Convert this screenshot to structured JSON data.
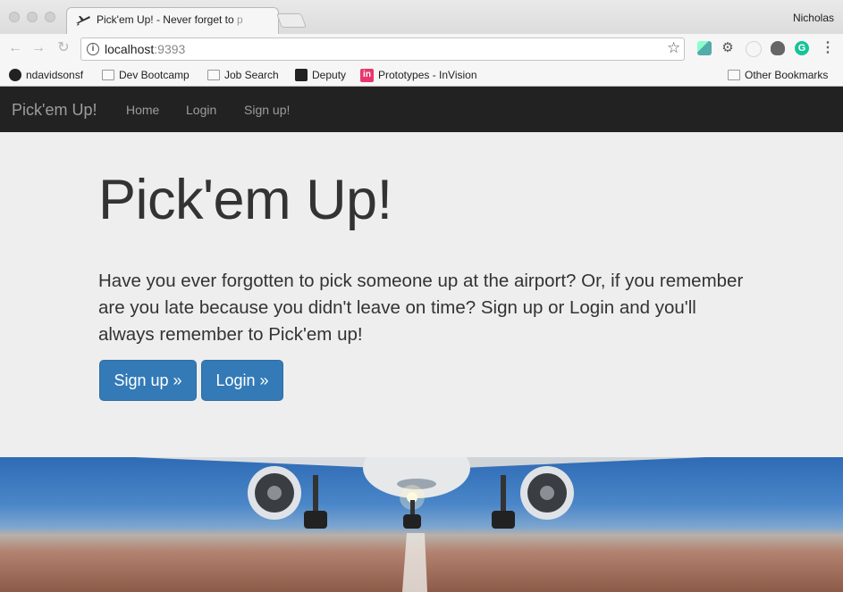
{
  "browser": {
    "tab_title": "Pick'em Up! - Never forget to ",
    "tab_title_faded": "p",
    "profile_name": "Nicholas",
    "url_host": "localhost",
    "url_port": ":9393",
    "bookmarks": [
      {
        "label": "ndavidsonsf",
        "icon": "github-icon"
      },
      {
        "label": "Dev Bootcamp",
        "icon": "folder-icon"
      },
      {
        "label": "Job Search",
        "icon": "folder-icon"
      },
      {
        "label": "Deputy",
        "icon": "deputy-icon"
      },
      {
        "label": "Prototypes - InVision",
        "icon": "invision-icon"
      }
    ],
    "other_bookmarks": "Other Bookmarks",
    "colors": {
      "chrome_bg": "#f6f6f6",
      "titlebar": "#dcdcdc"
    }
  },
  "navbar": {
    "brand": "Pick'em Up!",
    "links": [
      "Home",
      "Login",
      "Sign up!"
    ]
  },
  "hero": {
    "title": "Pick'em Up!",
    "text": "Have you ever forgotten to pick someone up at the airport? Or, if you remember are you late because you didn't leave on time? Sign up or Login and you'll always remember to Pick'em up!",
    "buttons": {
      "signup": "Sign up »",
      "login": "Login »"
    }
  },
  "colors": {
    "navbar_bg": "#222222",
    "jumbotron_bg": "#eeeeee",
    "primary_button": "#337ab7"
  }
}
